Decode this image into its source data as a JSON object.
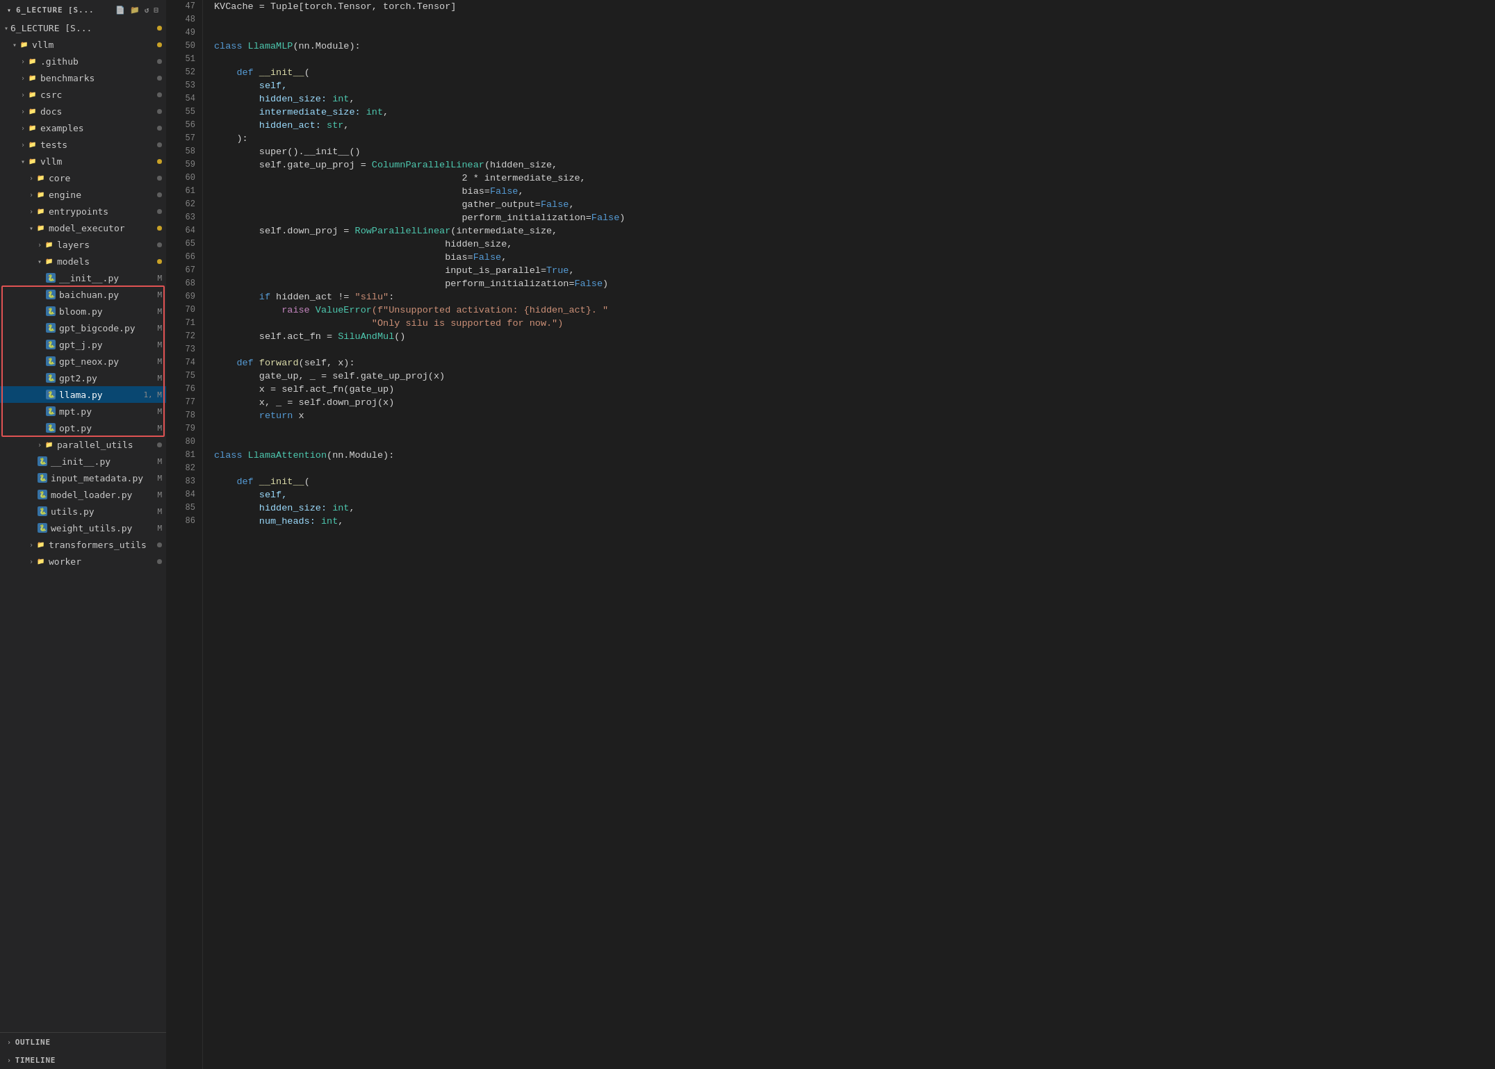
{
  "sidebar": {
    "title": "6_LECTURE [S...",
    "items": [
      {
        "id": "root",
        "label": "6_LECTURE [S...",
        "type": "root",
        "indent": 0,
        "expanded": true,
        "dot": "yellow"
      },
      {
        "id": "vllm-root",
        "label": "vllm",
        "type": "folder",
        "indent": 1,
        "expanded": true,
        "dot": "yellow"
      },
      {
        "id": "github",
        "label": ".github",
        "type": "folder",
        "indent": 2,
        "expanded": false,
        "dot": "plain"
      },
      {
        "id": "benchmarks",
        "label": "benchmarks",
        "type": "folder",
        "indent": 2,
        "expanded": false,
        "dot": "plain"
      },
      {
        "id": "csrc",
        "label": "csrc",
        "type": "folder",
        "indent": 2,
        "expanded": false,
        "dot": "plain"
      },
      {
        "id": "docs",
        "label": "docs",
        "type": "folder",
        "indent": 2,
        "expanded": false,
        "dot": "plain"
      },
      {
        "id": "examples",
        "label": "examples",
        "type": "folder",
        "indent": 2,
        "expanded": false,
        "dot": "plain"
      },
      {
        "id": "tests",
        "label": "tests",
        "type": "folder",
        "indent": 2,
        "expanded": false,
        "dot": "plain"
      },
      {
        "id": "vllm",
        "label": "vllm",
        "type": "folder",
        "indent": 2,
        "expanded": true,
        "dot": "yellow"
      },
      {
        "id": "core",
        "label": "core",
        "type": "folder",
        "indent": 3,
        "expanded": false,
        "dot": "plain"
      },
      {
        "id": "engine",
        "label": "engine",
        "type": "folder",
        "indent": 3,
        "expanded": false,
        "dot": "plain"
      },
      {
        "id": "entrypoints",
        "label": "entrypoints",
        "type": "folder",
        "indent": 3,
        "expanded": false,
        "dot": "plain"
      },
      {
        "id": "model_executor",
        "label": "model_executor",
        "type": "folder",
        "indent": 3,
        "expanded": true,
        "dot": "yellow"
      },
      {
        "id": "layers",
        "label": "layers",
        "type": "folder",
        "indent": 4,
        "expanded": false,
        "dot": "plain"
      },
      {
        "id": "models",
        "label": "models",
        "type": "folder",
        "indent": 4,
        "expanded": true,
        "dot": "yellow"
      },
      {
        "id": "__init__py_models",
        "label": "__init__.py",
        "type": "file",
        "indent": 5,
        "badge": "M",
        "dot": null
      },
      {
        "id": "baichuan",
        "label": "baichuan.py",
        "type": "file",
        "indent": 5,
        "badge": "M",
        "dot": null,
        "highlighted": true
      },
      {
        "id": "bloom",
        "label": "bloom.py",
        "type": "file",
        "indent": 5,
        "badge": "M",
        "dot": null,
        "highlighted": true
      },
      {
        "id": "gpt_bigcode",
        "label": "gpt_bigcode.py",
        "type": "file",
        "indent": 5,
        "badge": "M",
        "dot": null,
        "highlighted": true
      },
      {
        "id": "gpt_j",
        "label": "gpt_j.py",
        "type": "file",
        "indent": 5,
        "badge": "M",
        "dot": null,
        "highlighted": true
      },
      {
        "id": "gpt_neox",
        "label": "gpt_neox.py",
        "type": "file",
        "indent": 5,
        "badge": "M",
        "dot": null,
        "highlighted": true
      },
      {
        "id": "gpt2",
        "label": "gpt2.py",
        "type": "file",
        "indent": 5,
        "badge": "M",
        "dot": null,
        "highlighted": true
      },
      {
        "id": "llama",
        "label": "llama.py",
        "type": "file",
        "indent": 5,
        "badge": "1, M",
        "dot": null,
        "active": true
      },
      {
        "id": "mpt",
        "label": "mpt.py",
        "type": "file",
        "indent": 5,
        "badge": "M",
        "dot": null,
        "highlighted": true
      },
      {
        "id": "opt",
        "label": "opt.py",
        "type": "file",
        "indent": 5,
        "badge": "M",
        "dot": null,
        "highlighted": true
      },
      {
        "id": "parallel_utils",
        "label": "parallel_utils",
        "type": "folder",
        "indent": 4,
        "expanded": false,
        "dot": "plain"
      },
      {
        "id": "__init__py_vllm",
        "label": "__init__.py",
        "type": "file",
        "indent": 4,
        "badge": "M",
        "dot": null
      },
      {
        "id": "input_metadata",
        "label": "input_metadata.py",
        "type": "file",
        "indent": 4,
        "badge": "M",
        "dot": null
      },
      {
        "id": "model_loader",
        "label": "model_loader.py",
        "type": "file",
        "indent": 4,
        "badge": "M",
        "dot": null
      },
      {
        "id": "utils",
        "label": "utils.py",
        "type": "file",
        "indent": 4,
        "badge": "M",
        "dot": null
      },
      {
        "id": "weight_utils",
        "label": "weight_utils.py",
        "type": "file",
        "indent": 4,
        "badge": "M",
        "dot": null
      },
      {
        "id": "transformers_utils",
        "label": "transformers_utils",
        "type": "folder",
        "indent": 3,
        "expanded": false,
        "dot": "plain"
      },
      {
        "id": "worker",
        "label": "worker",
        "type": "folder",
        "indent": 3,
        "expanded": false,
        "dot": "plain"
      }
    ],
    "bottom": [
      {
        "id": "outline",
        "label": "OUTLINE"
      },
      {
        "id": "timeline",
        "label": "TIMELINE"
      }
    ]
  },
  "editor": {
    "lines": [
      {
        "num": 47,
        "tokens": [
          {
            "t": "KVCache = Tuple[torch.Tensor, torch.Tensor]",
            "c": "plain"
          }
        ]
      },
      {
        "num": 48,
        "tokens": []
      },
      {
        "num": 49,
        "tokens": []
      },
      {
        "num": 50,
        "tokens": [
          {
            "t": "class ",
            "c": "kw"
          },
          {
            "t": "LlamaMLP",
            "c": "cls"
          },
          {
            "t": "(nn.Module):",
            "c": "plain"
          }
        ]
      },
      {
        "num": 51,
        "tokens": []
      },
      {
        "num": 52,
        "tokens": [
          {
            "t": "    def ",
            "c": "kw"
          },
          {
            "t": "__init__",
            "c": "fn"
          },
          {
            "t": "(",
            "c": "plain"
          }
        ]
      },
      {
        "num": 53,
        "tokens": [
          {
            "t": "        self,",
            "c": "param"
          }
        ]
      },
      {
        "num": 54,
        "tokens": [
          {
            "t": "        hidden_size: ",
            "c": "param"
          },
          {
            "t": "int",
            "c": "type"
          },
          {
            "t": ",",
            "c": "plain"
          }
        ]
      },
      {
        "num": 55,
        "tokens": [
          {
            "t": "        intermediate_size: ",
            "c": "param"
          },
          {
            "t": "int",
            "c": "type"
          },
          {
            "t": ",",
            "c": "plain"
          }
        ]
      },
      {
        "num": 56,
        "tokens": [
          {
            "t": "        hidden_act: ",
            "c": "param"
          },
          {
            "t": "str",
            "c": "type"
          },
          {
            "t": ",",
            "c": "plain"
          }
        ]
      },
      {
        "num": 57,
        "tokens": [
          {
            "t": "    ):",
            "c": "plain"
          }
        ]
      },
      {
        "num": 58,
        "tokens": [
          {
            "t": "        super().__init__()",
            "c": "plain"
          }
        ]
      },
      {
        "num": 59,
        "tokens": [
          {
            "t": "        self.gate_up_proj = ",
            "c": "plain"
          },
          {
            "t": "ColumnParallelLinear",
            "c": "cls"
          },
          {
            "t": "(hidden_size,",
            "c": "plain"
          }
        ]
      },
      {
        "num": 60,
        "tokens": [
          {
            "t": "                                            2 * intermediate_size,",
            "c": "plain"
          }
        ]
      },
      {
        "num": 61,
        "tokens": [
          {
            "t": "                                            bias=",
            "c": "plain"
          },
          {
            "t": "False",
            "c": "bool"
          },
          {
            "t": ",",
            "c": "plain"
          }
        ]
      },
      {
        "num": 62,
        "tokens": [
          {
            "t": "                                            gather_output=",
            "c": "plain"
          },
          {
            "t": "False",
            "c": "bool"
          },
          {
            "t": ",",
            "c": "plain"
          }
        ]
      },
      {
        "num": 63,
        "tokens": [
          {
            "t": "                                            perform_initialization=",
            "c": "plain"
          },
          {
            "t": "False",
            "c": "bool"
          },
          {
            "t": ")",
            "c": "plain"
          }
        ]
      },
      {
        "num": 64,
        "tokens": [
          {
            "t": "        self.down_proj = ",
            "c": "plain"
          },
          {
            "t": "RowParallelLinear",
            "c": "cls"
          },
          {
            "t": "(intermediate_size,",
            "c": "plain"
          }
        ]
      },
      {
        "num": 65,
        "tokens": [
          {
            "t": "                                         hidden_size,",
            "c": "plain"
          }
        ]
      },
      {
        "num": 66,
        "tokens": [
          {
            "t": "                                         bias=",
            "c": "plain"
          },
          {
            "t": "False",
            "c": "bool"
          },
          {
            "t": ",",
            "c": "plain"
          }
        ]
      },
      {
        "num": 67,
        "tokens": [
          {
            "t": "                                         input_is_parallel=",
            "c": "plain"
          },
          {
            "t": "True",
            "c": "bool"
          },
          {
            "t": ",",
            "c": "plain"
          }
        ]
      },
      {
        "num": 68,
        "tokens": [
          {
            "t": "                                         perform_initialization=",
            "c": "plain"
          },
          {
            "t": "False",
            "c": "bool"
          },
          {
            "t": ")",
            "c": "plain"
          }
        ]
      },
      {
        "num": 69,
        "tokens": [
          {
            "t": "        ",
            "c": "plain"
          },
          {
            "t": "if",
            "c": "kw"
          },
          {
            "t": " hidden_act != ",
            "c": "plain"
          },
          {
            "t": "\"silu\"",
            "c": "str"
          },
          {
            "t": ":",
            "c": "plain"
          }
        ]
      },
      {
        "num": 70,
        "tokens": [
          {
            "t": "            ",
            "c": "plain"
          },
          {
            "t": "raise",
            "c": "kw2"
          },
          {
            "t": " ",
            "c": "plain"
          },
          {
            "t": "ValueError",
            "c": "cls"
          },
          {
            "t": "(f\"Unsupported activation: {hidden_act}. \"",
            "c": "str"
          }
        ]
      },
      {
        "num": 71,
        "tokens": [
          {
            "t": "                            ",
            "c": "plain"
          },
          {
            "t": "\"Only silu is supported for now.\")",
            "c": "str"
          }
        ]
      },
      {
        "num": 72,
        "tokens": [
          {
            "t": "        self.act_fn = ",
            "c": "plain"
          },
          {
            "t": "SiluAndMul",
            "c": "cls"
          },
          {
            "t": "()",
            "c": "plain"
          }
        ]
      },
      {
        "num": 73,
        "tokens": []
      },
      {
        "num": 74,
        "tokens": [
          {
            "t": "    ",
            "c": "plain"
          },
          {
            "t": "def ",
            "c": "kw"
          },
          {
            "t": "forward",
            "c": "fn"
          },
          {
            "t": "(self, x):",
            "c": "plain"
          }
        ]
      },
      {
        "num": 75,
        "tokens": [
          {
            "t": "        gate_up, _ = self.gate_up_proj(x)",
            "c": "plain"
          }
        ]
      },
      {
        "num": 76,
        "tokens": [
          {
            "t": "        x = self.act_fn(gate_up)",
            "c": "plain"
          }
        ]
      },
      {
        "num": 77,
        "tokens": [
          {
            "t": "        x, _ = self.down_proj(x)",
            "c": "plain"
          }
        ]
      },
      {
        "num": 78,
        "tokens": [
          {
            "t": "        ",
            "c": "plain"
          },
          {
            "t": "return",
            "c": "kw"
          },
          {
            "t": " x",
            "c": "plain"
          }
        ]
      },
      {
        "num": 79,
        "tokens": []
      },
      {
        "num": 80,
        "tokens": []
      },
      {
        "num": 81,
        "tokens": [
          {
            "t": "class ",
            "c": "kw"
          },
          {
            "t": "LlamaAttention",
            "c": "cls"
          },
          {
            "t": "(nn.Module):",
            "c": "plain"
          }
        ]
      },
      {
        "num": 82,
        "tokens": []
      },
      {
        "num": 83,
        "tokens": [
          {
            "t": "    ",
            "c": "plain"
          },
          {
            "t": "def ",
            "c": "kw"
          },
          {
            "t": "__init__",
            "c": "fn"
          },
          {
            "t": "(",
            "c": "plain"
          }
        ]
      },
      {
        "num": 84,
        "tokens": [
          {
            "t": "        self,",
            "c": "param"
          }
        ]
      },
      {
        "num": 85,
        "tokens": [
          {
            "t": "        hidden_size: ",
            "c": "param"
          },
          {
            "t": "int",
            "c": "type"
          },
          {
            "t": ",",
            "c": "plain"
          }
        ]
      },
      {
        "num": 86,
        "tokens": [
          {
            "t": "        num_heads: ",
            "c": "param"
          },
          {
            "t": "int",
            "c": "type"
          },
          {
            "t": ",",
            "c": "plain"
          }
        ]
      }
    ]
  }
}
